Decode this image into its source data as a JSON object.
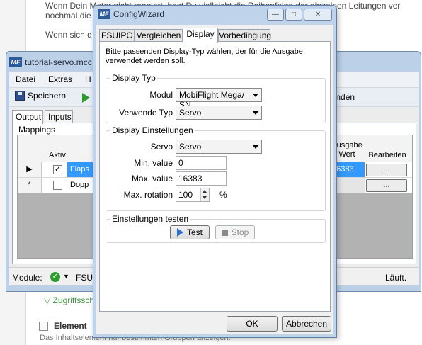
{
  "background": {
    "line1": "Wenn Dein Motor nicht reagiert, hast Du vielleicht die Reihenfolge der einzelnen Leitungen ver",
    "line2": "nochmal die",
    "line3": "Wenn sich d",
    "link": "▽ Zugriffssch",
    "element_label": "Element",
    "element_desc": "Das Inhaltselement nur bestimmten Gruppen anzeigen."
  },
  "main_window": {
    "title": "tutorial-servo.mcc",
    "logo": "MF",
    "menu": [
      "Datei",
      "Extras",
      "H"
    ],
    "toolbar": {
      "save_label": "Speichern",
      "end_label": "eenden"
    },
    "tabs": [
      "Output",
      "Inputs"
    ],
    "mappings_label": "Mappings",
    "grid": {
      "col_aktiv": "Aktiv",
      "col_ausgabe": "Ausgabe",
      "col_wert": "Wert",
      "col_bearbeiten": "Bearbeiten",
      "rows": [
        {
          "marker": "▶",
          "checked": "✓",
          "name": "Flaps",
          "value": "16383",
          "edit": "..."
        },
        {
          "marker": "*",
          "checked": "",
          "name": "Dopp",
          "value": "",
          "edit": "..."
        }
      ]
    },
    "status": {
      "module_label": "Module:",
      "fsuipc_label": "FSUIPC",
      "running_label": "Läuft."
    }
  },
  "dialog": {
    "title": "ConfigWizard",
    "logo": "MF",
    "controls": {
      "minimize": "—",
      "maximize": "□",
      "close": "✕"
    },
    "tabs": [
      "FSUIPC",
      "Vergleichen",
      "Display",
      "Vorbedingung"
    ],
    "active_tab": "Display",
    "description": "Bitte passenden Display-Typ wählen, der für die Ausgabe verwendet werden soll.",
    "display_type": {
      "legend": "Display Typ",
      "module_label": "Modul",
      "module_value": "MobiFlight Mega/ SN",
      "use_type_label": "Verwende Typ",
      "use_type_value": "Servo"
    },
    "display_settings": {
      "legend": "Display Einstellungen",
      "servo_label": "Servo",
      "servo_value": "Servo",
      "min_label": "Min. value",
      "min_value": "0",
      "max_label": "Max. value",
      "max_value": "16383",
      "rotation_label": "Max. rotation",
      "rotation_value": "100",
      "rotation_unit": "%"
    },
    "test_settings": {
      "legend": "Einstellungen testen",
      "test_label": "Test",
      "stop_label": "Stop"
    },
    "ok_label": "OK",
    "cancel_label": "Abbrechen"
  }
}
